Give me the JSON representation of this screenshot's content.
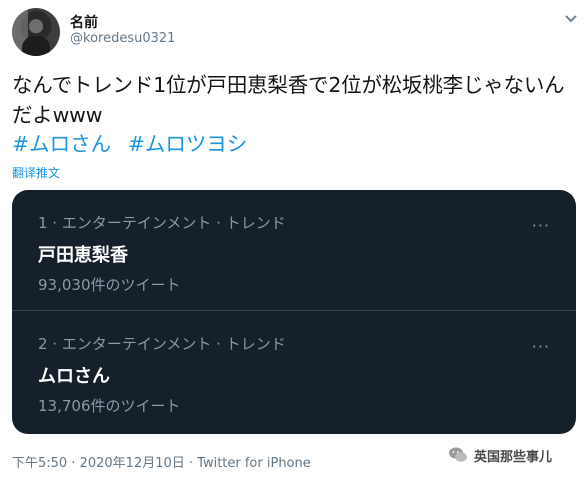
{
  "tweet": {
    "display_name": "名前",
    "handle": "@koredesu0321",
    "text": "なんでトレンド1位が戸田恵梨香で2位が松坂桃李じゃないんだよwww",
    "hashtags": [
      "#ムロさん",
      "#ムロツヨシ"
    ],
    "translate_label": "翻译推文",
    "meta": "下午5:50 · 2020年12月10日 · Twitter for iPhone"
  },
  "trends": [
    {
      "context": "1 · エンターテインメント · トレンド",
      "title": "戸田恵梨香",
      "count": "93,030件のツイート",
      "more": "···"
    },
    {
      "context": "2 · エンターテインメント · トレンド",
      "title": "ムロさん",
      "count": "13,706件のツイート",
      "more": "···"
    }
  ],
  "watermark": {
    "text": "英国那些事儿",
    "icon": "wechat-icon"
  },
  "icons": {
    "caret": "chevron-down-icon",
    "avatar": "avatar"
  },
  "colors": {
    "link": "#1b95e0",
    "card_bg": "#15202b",
    "muted": "#657786",
    "card_muted": "#8899a6"
  }
}
